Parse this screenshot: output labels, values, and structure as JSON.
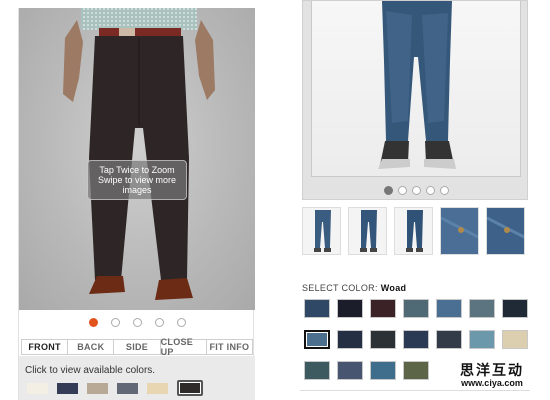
{
  "left_panel": {
    "zoom_hint": {
      "line1": "Tap Twice to Zoom",
      "line2": "Swipe to view more",
      "line3": "images"
    },
    "pager": {
      "count": 5,
      "active_index": 0,
      "active_color": "#e2531d"
    },
    "view_tabs": [
      {
        "label": "FRONT",
        "active": true
      },
      {
        "label": "BACK",
        "active": false
      },
      {
        "label": "SIDE",
        "active": false
      },
      {
        "label": "CLOSE UP",
        "active": false
      },
      {
        "label": "FIT INFO",
        "active": false
      }
    ],
    "available_colors_text": "Click to view available colors.",
    "swatches": [
      {
        "color": "#f4efe4",
        "selected": false
      },
      {
        "color": "#343c56",
        "selected": false
      },
      {
        "color": "#b8a896",
        "selected": false
      },
      {
        "color": "#626875",
        "selected": false
      },
      {
        "color": "#e8d6b2",
        "selected": false
      },
      {
        "color": "#2e2a2a",
        "selected": true
      }
    ]
  },
  "right_panel": {
    "pager": {
      "count": 5,
      "active_index": 0,
      "active_color": "#777777"
    },
    "thumbnails": [
      "front-view",
      "back-view",
      "side-view",
      "detail-view",
      "label-view"
    ],
    "select_color": {
      "label": "SELECT COLOR:",
      "value": "Woad"
    },
    "color_swatches": [
      {
        "color": "#2f4866",
        "selected": false
      },
      {
        "color": "#1b1e2a",
        "selected": false
      },
      {
        "color": "#3b2226",
        "selected": false
      },
      {
        "color": "#4f6975",
        "selected": false
      },
      {
        "color": "#4a6f93",
        "selected": false
      },
      {
        "color": "#5c7480",
        "selected": false
      },
      {
        "color": "#1f2a36",
        "selected": false
      },
      {
        "color": "#4d6f8e",
        "selected": true
      },
      {
        "color": "#252f44",
        "selected": false
      },
      {
        "color": "#2b3135",
        "selected": false
      },
      {
        "color": "#2a3a55",
        "selected": false
      },
      {
        "color": "#333b49",
        "selected": false
      },
      {
        "color": "#6b98aa",
        "selected": false
      },
      {
        "color": "#dccfb0",
        "selected": false
      },
      {
        "color": "#3d5a60",
        "selected": false
      },
      {
        "color": "#485570",
        "selected": false
      },
      {
        "color": "#3f6d8c",
        "selected": false
      },
      {
        "color": "#5c6548",
        "selected": false
      }
    ]
  },
  "watermark": {
    "text": "思洋互动",
    "url": "www.ciya.com"
  }
}
